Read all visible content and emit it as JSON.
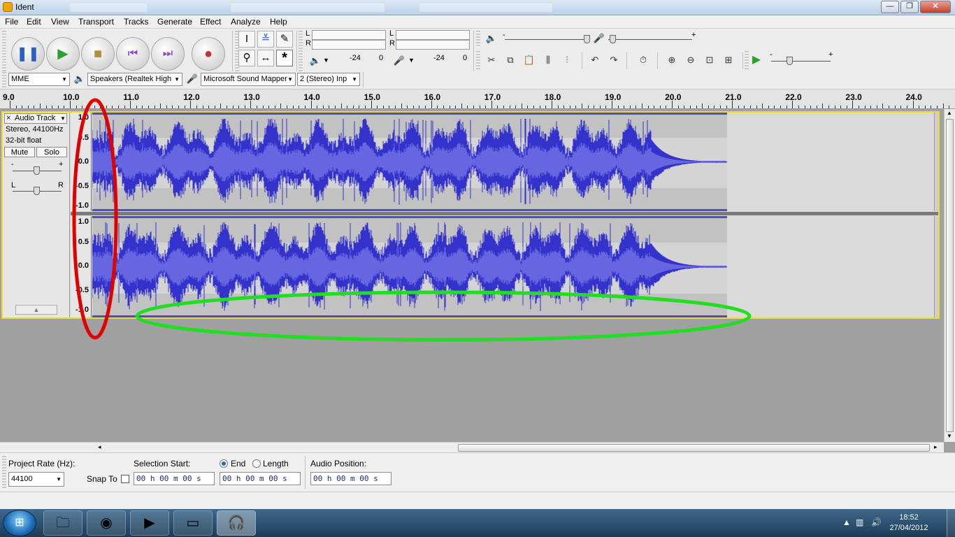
{
  "window": {
    "title": "Ident"
  },
  "menu": [
    "File",
    "Edit",
    "View",
    "Transport",
    "Tracks",
    "Generate",
    "Effect",
    "Analyze",
    "Help"
  ],
  "meters": {
    "playback_channels": [
      "L",
      "R"
    ],
    "record_channels": [
      "L",
      "R"
    ],
    "playback_ticks": [
      "-24",
      "0"
    ],
    "record_ticks": [
      "-24",
      "0"
    ]
  },
  "mixer": {
    "minus": "-",
    "plus": "+"
  },
  "play_speed": {
    "minus": "-",
    "plus": "+"
  },
  "device": {
    "host": "MME",
    "output": "Speakers (Realtek High",
    "input": "Microsoft Sound Mapper",
    "channels": "2 (Stereo) Inp"
  },
  "ruler_ticks": [
    "9.0",
    "10.0",
    "11.0",
    "12.0",
    "13.0",
    "14.0",
    "15.0",
    "16.0",
    "17.0",
    "18.0",
    "19.0",
    "20.0",
    "21.0",
    "22.0",
    "23.0",
    "24.0"
  ],
  "track": {
    "name": "Audio Track",
    "close": "×",
    "info_rate": "Stereo, 44100Hz",
    "info_format": "32-bit float",
    "mute": "Mute",
    "solo": "Solo",
    "gain_minus": "-",
    "gain_plus": "+",
    "pan_left": "L",
    "pan_right": "R"
  },
  "amplitude_labels": {
    "ch1": [
      "1.0",
      "0.5",
      "0.0",
      "-0.5",
      "-1.0"
    ],
    "ch2": [
      "1.0",
      "0.5",
      "0.0",
      "-0.5",
      "-1.0"
    ]
  },
  "selection_toolbar": {
    "project_rate_label": "Project Rate (Hz):",
    "project_rate_value": "44100",
    "snap_to_label": "Snap To",
    "selection_start_label": "Selection Start:",
    "end_label": "End",
    "length_label": "Length",
    "audio_position_label": "Audio Position:",
    "selection_start_value": "00 h 00 m 00 s",
    "end_value": "00 h 00 m 00 s",
    "audio_position_value": "00 h 00 m 00 s"
  },
  "annotations": {
    "red_ellipse_color": "#e00000",
    "green_ellipse_color": "#22dd22"
  },
  "colors": {
    "waveform": "#3333cc",
    "waveform_rms": "#6666e0",
    "selection_border": "#f0dc28"
  },
  "taskbar": {
    "time": "18:52",
    "date": "27/04/2012"
  }
}
